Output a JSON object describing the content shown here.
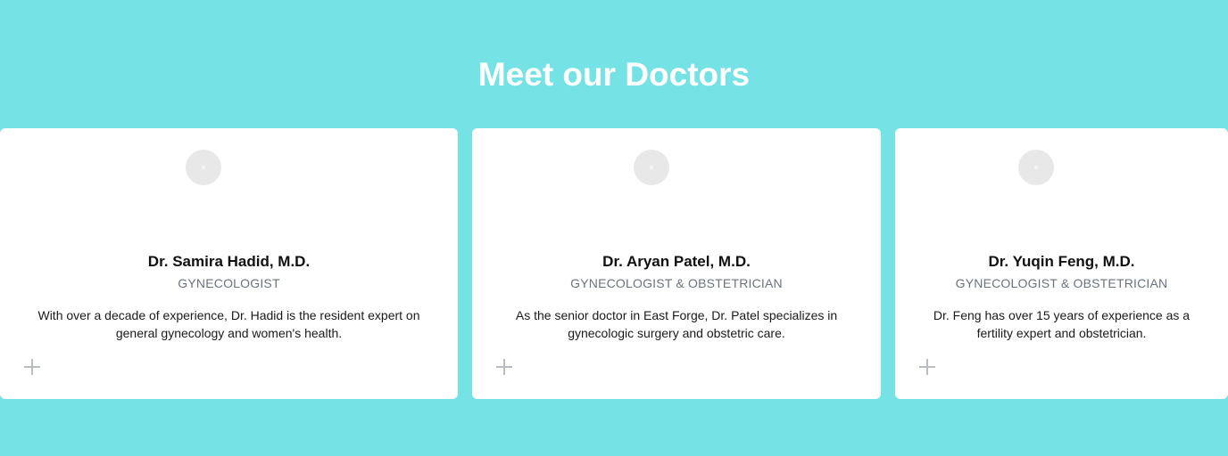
{
  "section": {
    "title": "Meet our Doctors"
  },
  "doctors": [
    {
      "name": "Dr. Samira Hadid, M.D.",
      "role": "GYNECOLOGIST",
      "description": "With over a decade of experience, Dr. Hadid is the resident expert on general gynecology and women's health.",
      "expand_icon": "plus-icon",
      "avatar_icon": "avatar-placeholder"
    },
    {
      "name": "Dr. Aryan Patel, M.D.",
      "role": "GYNECOLOGIST & OBSTETRICIAN",
      "description": "As the senior doctor in East Forge, Dr. Patel specializes in gynecologic surgery and obstetric care.",
      "expand_icon": "plus-icon",
      "avatar_icon": "avatar-placeholder"
    },
    {
      "name": "Dr. Yuqin Feng, M.D.",
      "role": "GYNECOLOGIST & OBSTETRICIAN",
      "description": "Dr. Feng has over 15 years of experience as a fertility expert and obstetrician.",
      "expand_icon": "plus-icon",
      "avatar_icon": "avatar-placeholder"
    }
  ],
  "colors": {
    "background": "#75e3e6",
    "card": "#ffffff",
    "title": "#ffffff",
    "role_text": "#6b7280",
    "plus_icon": "#b9bcc0",
    "avatar": "#e8e8e8"
  }
}
